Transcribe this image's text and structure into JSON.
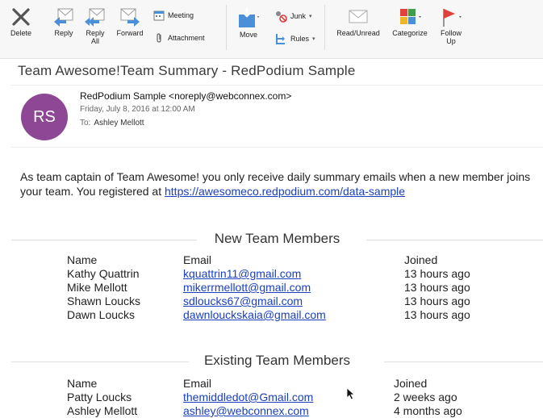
{
  "toolbar": {
    "delete": "Delete",
    "reply": "Reply",
    "reply_all_line1": "Reply",
    "reply_all_line2": "All",
    "forward": "Forward",
    "meeting": "Meeting",
    "attachment": "Attachment",
    "move": "Move",
    "junk": "Junk",
    "rules": "Rules",
    "read_unread": "Read/Unread",
    "categorize": "Categorize",
    "follow_line1": "Follow",
    "follow_line2": "Up"
  },
  "email": {
    "subject": "Team Awesome!Team Summary - RedPodium Sample",
    "avatar_initials": "RS",
    "avatar_color": "#8e4794",
    "sender": "RedPodium Sample <noreply@webconnex.com>",
    "date": "Friday, July 8, 2016 at 12:00 AM",
    "to_label": "To:",
    "to_name": "Ashley Mellott",
    "intro_text": "As team captain of Team Awesome! you only receive daily summary emails when a new member joins your team. You registered at ",
    "intro_link": "https://awesomeco.redpodium.com/data-sample"
  },
  "new_members": {
    "title": "New Team Members",
    "headers": {
      "name": "Name",
      "email": "Email",
      "joined": "Joined"
    },
    "rows": [
      {
        "name": "Kathy Quattrin",
        "email": "kquattrin11@gmail.com",
        "joined": "13 hours ago"
      },
      {
        "name": "Mike Mellott",
        "email": "mikerrmellott@gmail.com",
        "joined": "13 hours ago"
      },
      {
        "name": "Shawn Loucks",
        "email": "sdloucks67@gmail.com",
        "joined": "13 hours ago"
      },
      {
        "name": "Dawn Loucks",
        "email": "dawnlouckskaia@gmail.com",
        "joined": "13 hours ago"
      }
    ]
  },
  "existing_members": {
    "title": "Existing Team Members",
    "headers": {
      "name": "Name",
      "email": "Email",
      "joined": "Joined"
    },
    "rows": [
      {
        "name": "Patty Loucks",
        "email": "themiddledot@Gmail.com",
        "joined": "2 weeks ago"
      },
      {
        "name": "Ashley Mellott",
        "email": "ashley@webconnex.com",
        "joined": "4 months ago"
      }
    ]
  },
  "colors": {
    "link": "#1a3fbf",
    "accent_blue": "#4a8fd8",
    "flag_red": "#e0403a"
  }
}
